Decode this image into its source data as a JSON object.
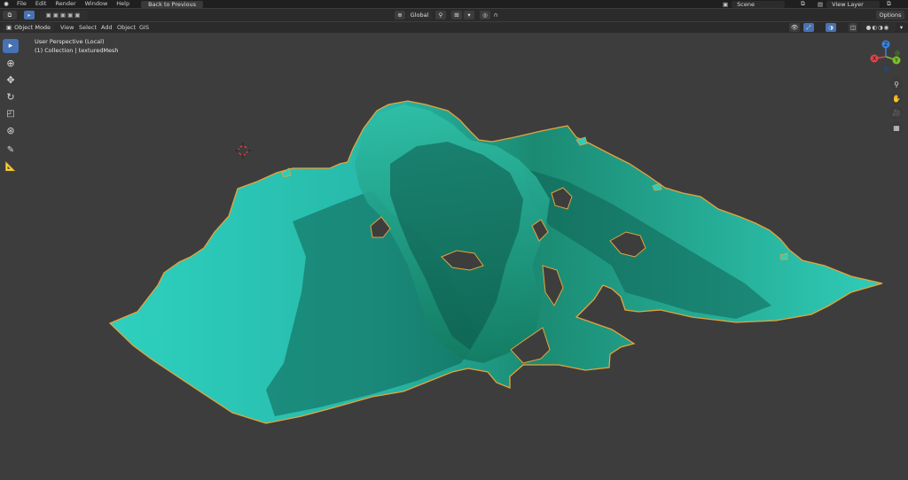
{
  "topbar": {
    "menus": [
      "File",
      "Edit",
      "Render",
      "Window",
      "Help"
    ],
    "back_label": "Back to Previous",
    "scene_label": "Scene",
    "view_layer_label": "View Layer"
  },
  "header": {
    "transform_orientation": "Global",
    "options_label": "Options"
  },
  "viewport_header": {
    "mode_label": "Object Mode",
    "menus": [
      "View",
      "Select",
      "Add",
      "Object",
      "GIS"
    ]
  },
  "viewport": {
    "perspective_label": "User Perspective (Local)",
    "collection_label": "(1) Collection | texturedMesh"
  },
  "gizmo": {
    "x_label": "X",
    "y_label": "Y",
    "z_label": "Z"
  },
  "colors": {
    "selection_outline": "#e8a33a",
    "axis_x": "#e2424a",
    "axis_y": "#7bbf2a",
    "axis_z": "#3a82e0",
    "mesh_light": "#28c9b6",
    "mesh_dark": "#0b5a52"
  }
}
